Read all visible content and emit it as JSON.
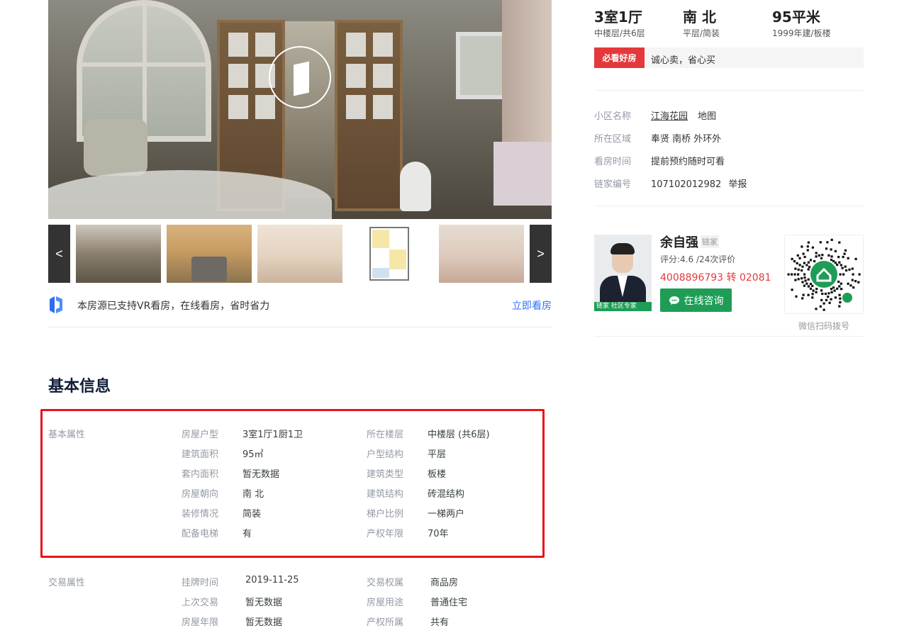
{
  "gallery": {
    "prev_label": "<",
    "next_label": ">",
    "vr_text": "本房源已支持VR看房，在线看房，省时省力",
    "vr_link": "立即看房"
  },
  "summary": {
    "room": {
      "main": "3室1厅",
      "sub": "中楼层/共6层"
    },
    "orientation": {
      "main": "南 北",
      "sub": "平层/简装"
    },
    "area": {
      "main": "95平米",
      "sub": "1999年建/板楼"
    }
  },
  "tag": {
    "badge": "必看好房",
    "text": "诚心卖，省心买"
  },
  "info": {
    "community_label": "小区名称",
    "community_value": "江海花园",
    "community_map": "地图",
    "region_label": "所在区域",
    "region_value": "奉贤 南桥 外环外",
    "visit_label": "看房时间",
    "visit_value": "提前预约随时可看",
    "id_label": "链家编号",
    "id_value": "107102012982",
    "id_report": "举报"
  },
  "agent": {
    "name": "余自强",
    "tag": "链家",
    "rating": "评分:4.6 /24次评价",
    "phone": "4008896793 转 02081",
    "consult": "在线咨询",
    "badge": "链家 社区专家",
    "qr_caption": "微信扫码拨号"
  },
  "basic_info": {
    "title": "基本信息",
    "basic_group": "基本属性",
    "basic_rows": [
      {
        "l1": "房屋户型",
        "v1": "3室1厅1厨1卫",
        "l2": "所在楼层",
        "v2": "中楼层 (共6层)"
      },
      {
        "l1": "建筑面积",
        "v1": "95㎡",
        "l2": "户型结构",
        "v2": "平层"
      },
      {
        "l1": "套内面积",
        "v1": "暂无数据",
        "l2": "建筑类型",
        "v2": "板楼"
      },
      {
        "l1": "房屋朝向",
        "v1": "南 北",
        "l2": "建筑结构",
        "v2": "砖混结构"
      },
      {
        "l1": "装修情况",
        "v1": "简装",
        "l2": "梯户比例",
        "v2": "一梯两户"
      },
      {
        "l1": "配备电梯",
        "v1": "有",
        "l2": "产权年限",
        "v2": "70年"
      }
    ],
    "trade_group": "交易属性",
    "trade_rows": [
      {
        "l1": "挂牌时间",
        "v1": "2019-11-25",
        "l2": "交易权属",
        "v2": "商品房"
      },
      {
        "l1": "上次交易",
        "v1": "暂无数据",
        "l2": "房屋用途",
        "v2": "普通住宅"
      },
      {
        "l1": "房屋年限",
        "v1": "暂无数据",
        "l2": "产权所属",
        "v2": "共有"
      }
    ]
  },
  "colors": {
    "accent_red": "#e4393c",
    "highlight_red": "#e8131c",
    "link_blue": "#3072f6",
    "consult_green": "#1f9d57"
  }
}
